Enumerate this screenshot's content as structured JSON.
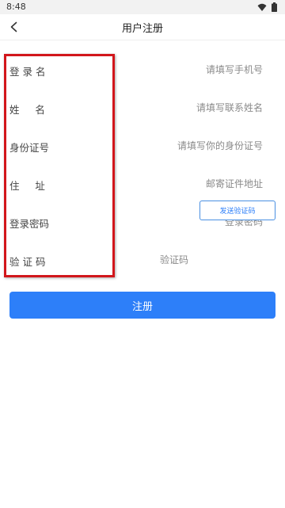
{
  "status_bar": {
    "time": "8:48",
    "icons": [
      "wifi-icon",
      "battery-icon"
    ]
  },
  "nav": {
    "back_icon": "chevron-left-icon",
    "title": "用户注册"
  },
  "form": {
    "rows": [
      {
        "label": "登 录 名",
        "placeholder": "请填写手机号",
        "value": ""
      },
      {
        "label": "姓     名",
        "placeholder": "请填写联系姓名",
        "value": ""
      },
      {
        "label": "身份证号",
        "placeholder": "请填写你的身份证号",
        "value": ""
      },
      {
        "label": "住     址",
        "placeholder": "邮寄证件地址",
        "value": ""
      },
      {
        "label": "登录密码",
        "placeholder": "登录密码",
        "value": ""
      },
      {
        "label": "验 证 码",
        "placeholder": "验证码",
        "value": ""
      }
    ],
    "send_code_label": "发送验证码"
  },
  "register_label": "注册",
  "colors": {
    "accent": "#2d7ff9",
    "highlight": "#d2161b",
    "placeholder": "#8a8a8a"
  }
}
